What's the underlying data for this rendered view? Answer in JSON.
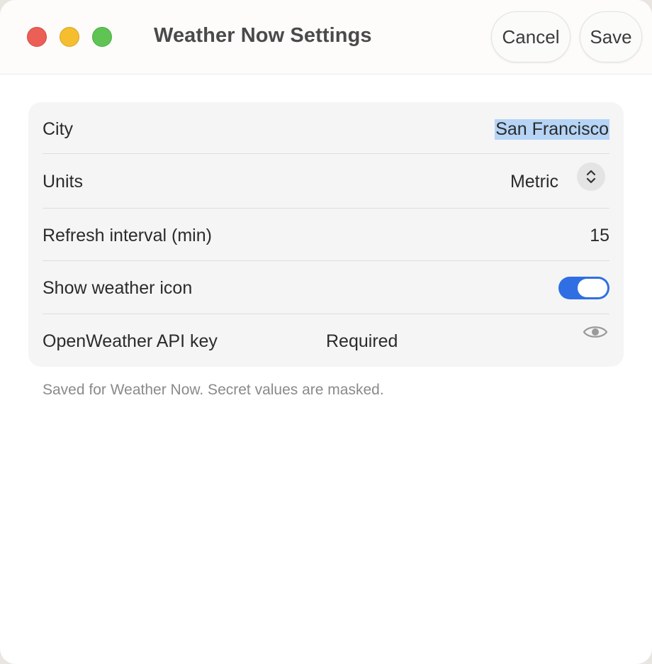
{
  "window": {
    "title": "Weather Now Settings",
    "cancel_label": "Cancel",
    "save_label": "Save"
  },
  "settings": {
    "city": {
      "label": "City",
      "value": "San Francisco",
      "selected": true
    },
    "units": {
      "label": "Units",
      "value": "Metric",
      "control_icon": "up-down-chevron-icon"
    },
    "refresh": {
      "label": "Refresh interval (min)",
      "value": "15"
    },
    "show_icon": {
      "label": "Show weather icon",
      "enabled": true
    },
    "api_key": {
      "label": "OpenWeather API key",
      "placeholder": "Required",
      "reveal_icon": "eye-icon"
    }
  },
  "footnote": "Saved for Weather Now. Secret values are masked.",
  "colors": {
    "accent": "#2f6fe3",
    "selection": "#b6d4f6",
    "traffic_close": "#ec5f57",
    "traffic_minimize": "#f4be2f",
    "traffic_maximize": "#5fc453"
  }
}
